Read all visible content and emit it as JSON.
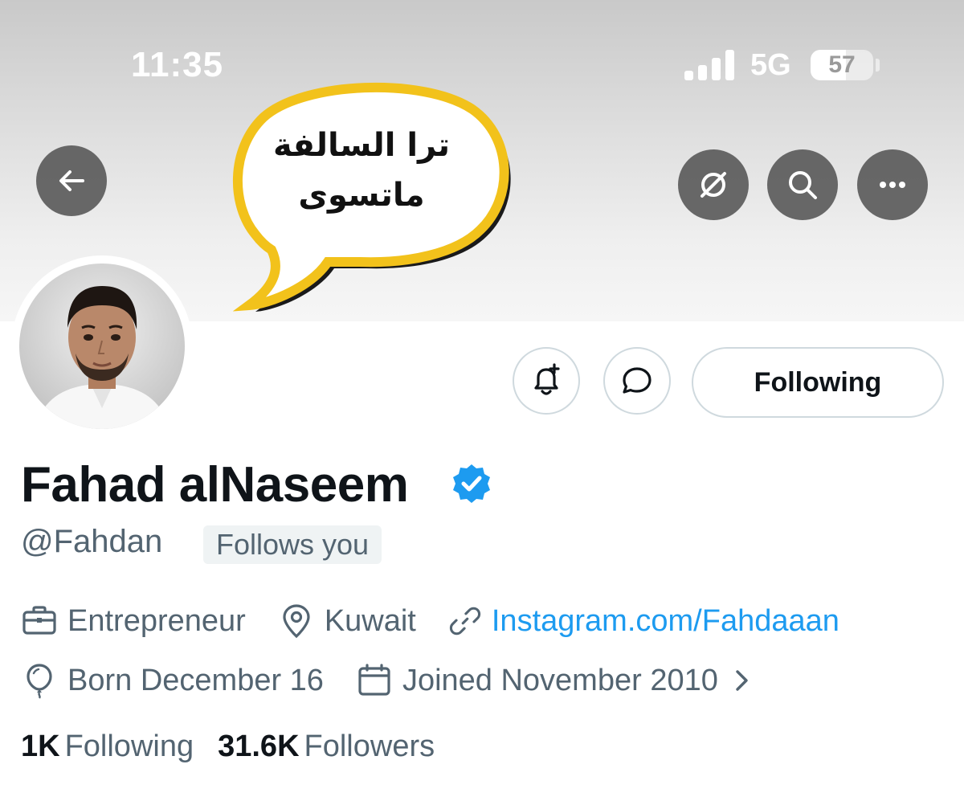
{
  "status_bar": {
    "time": "11:35",
    "network": "5G",
    "battery": "57",
    "battery_level": 0.57
  },
  "header": {
    "banner_text_line1": "ترا السالفة",
    "banner_text_line2": "ماتسوى",
    "icons": [
      "back-arrow-icon",
      "grok-icon",
      "search-icon",
      "more-icon"
    ]
  },
  "actions": {
    "following_label": "Following",
    "icons": [
      "notification-add-icon",
      "message-icon"
    ]
  },
  "profile": {
    "display_name": "Fahad alNaseem",
    "handle": "@Fahdan",
    "follows_you": "Follows you",
    "profession": "Entrepreneur",
    "location": "Kuwait",
    "website": "Instagram.com/Fahdaaan",
    "birthday": "Born December 16",
    "joined": "Joined November 2010",
    "following_count": "1K",
    "following_label": "Following",
    "followers_count": "31.6K",
    "followers_label": "Followers"
  },
  "colors": {
    "accent": "#1d9bf0",
    "secondary_text": "#536471",
    "banner_yellow": "#f2c21b"
  }
}
